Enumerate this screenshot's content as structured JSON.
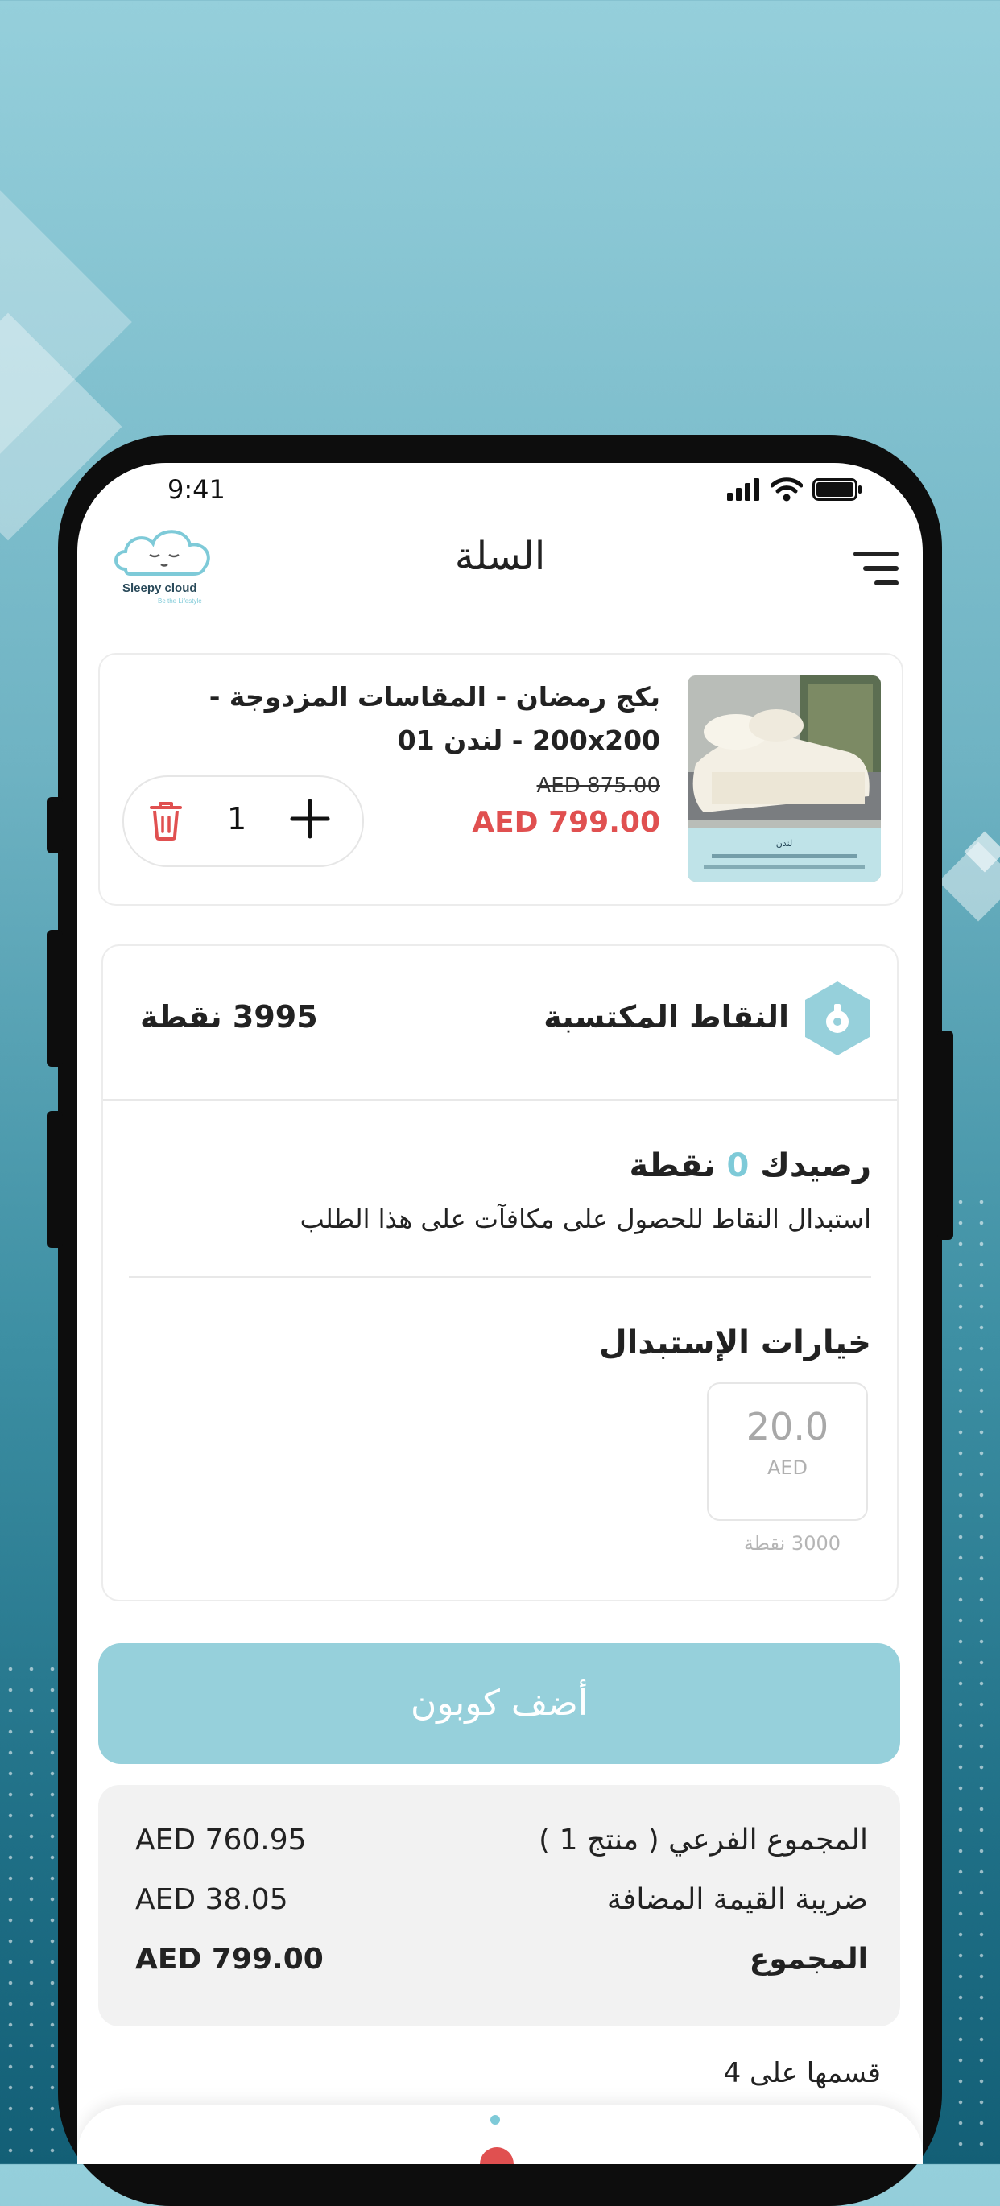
{
  "status_bar": {
    "time": "9:41"
  },
  "header": {
    "title": "السلة",
    "logo_text": "Sleepy cloud",
    "logo_tagline": "Be the Lifestyle"
  },
  "cart_item": {
    "name": "بكج رمضان - المقاسات المزدوجة - 200x200 - لندن 01",
    "old_price": "AED 875.00",
    "price": "AED 799.00",
    "quantity": "1",
    "image_caption": "لندن"
  },
  "points": {
    "title": "النقاط المكتسبة",
    "value": "3995 نقطة",
    "balance_prefix": "رصيدك",
    "balance_value": "0",
    "balance_suffix": "نقطة",
    "description": "استبدال النقاط للحصول على مكافآت على هذا الطلب",
    "options_title": "خيارات الإستبدال",
    "option": {
      "value": "20.0",
      "currency": "AED",
      "points": "3000 نقطة"
    }
  },
  "coupon_button": "أضف كوبون",
  "summary": {
    "rows": [
      {
        "label": "المجموع الفرعي ( منتج 1 )",
        "amount": "AED 760.95"
      },
      {
        "label": "ضريبة القيمة المضافة",
        "amount": "AED 38.05"
      },
      {
        "label": "المجموع",
        "amount": "AED 799.00"
      }
    ]
  },
  "split_text": "قسمها على 4",
  "colors": {
    "accent": "#96d0db",
    "price_red": "#e05050",
    "zero_color": "#7ecad8"
  }
}
